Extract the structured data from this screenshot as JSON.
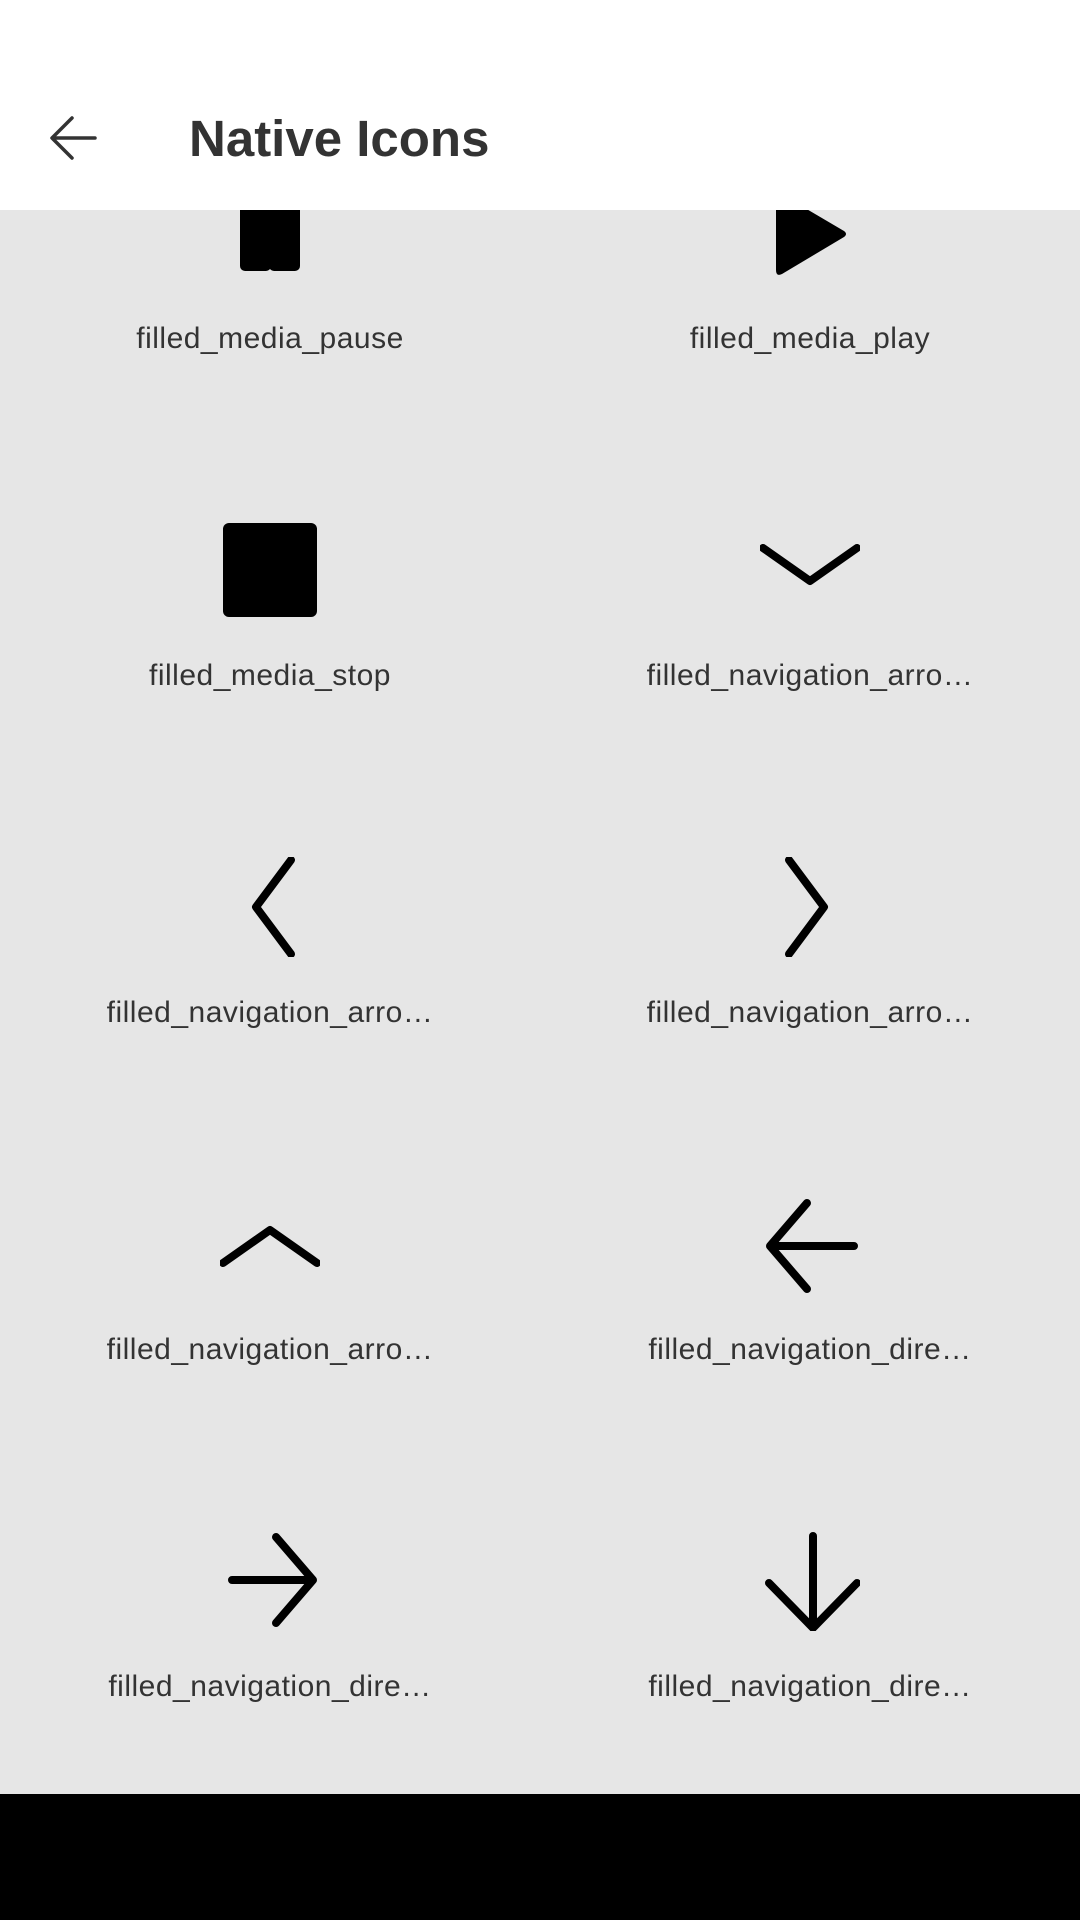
{
  "app_bar": {
    "back_icon": "arrow-back-icon",
    "title": "Native Icons"
  },
  "icons": [
    {
      "label": "filled_media_pause",
      "icon": "pause-icon"
    },
    {
      "label": "filled_media_play",
      "icon": "play-icon"
    },
    {
      "label": "filled_media_stop",
      "icon": "stop-icon"
    },
    {
      "label": "filled_navigation_arro…",
      "icon": "chevron-down-icon"
    },
    {
      "label": "filled_navigation_arro…",
      "icon": "chevron-left-icon"
    },
    {
      "label": "filled_navigation_arro…",
      "icon": "chevron-right-icon"
    },
    {
      "label": "filled_navigation_arro…",
      "icon": "chevron-up-icon"
    },
    {
      "label": "filled_navigation_dire…",
      "icon": "arrow-left-icon"
    },
    {
      "label": "filled_navigation_dire…",
      "icon": "arrow-right-icon"
    },
    {
      "label": "filled_navigation_dire…",
      "icon": "arrow-down-icon"
    }
  ],
  "colors": {
    "background": "#e6e6e6",
    "app_bar": "#ffffff",
    "text": "#333333",
    "icon": "#000000"
  }
}
